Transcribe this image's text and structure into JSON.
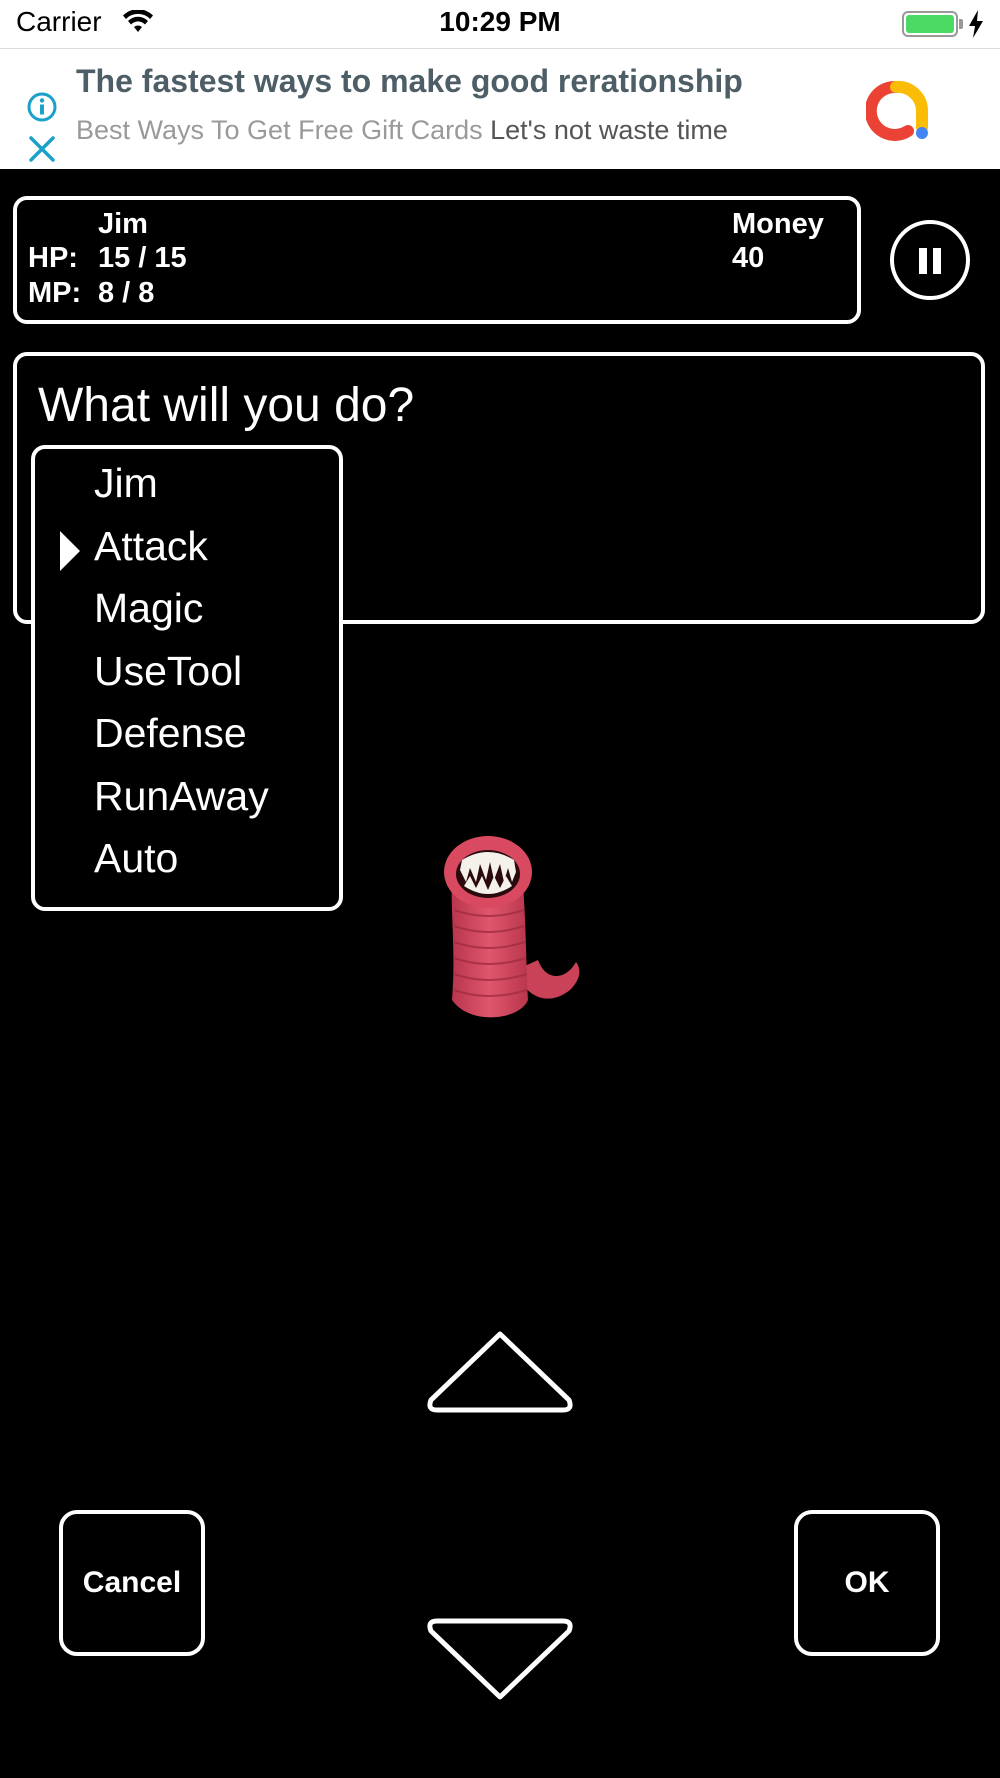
{
  "status_bar": {
    "carrier": "Carrier",
    "time": "10:29 PM",
    "wifi_icon": "wifi-icon",
    "battery_icon": "battery-icon",
    "charging_icon": "bolt-icon",
    "battery_color": "#4cd964"
  },
  "ad": {
    "title": "The fastest ways to make good rerationship",
    "subtitle_part1": "Best Ways To Get Free Gift Cards",
    "subtitle_part2": "Let's not waste time",
    "info_icon": "info-icon",
    "close_icon": "close-icon",
    "logo_icon": "advertiser-logo-icon",
    "accent_color": "#1ba1c9"
  },
  "party": {
    "name": "Jim",
    "hp_label": "HP:",
    "hp_value": "15 / 15",
    "mp_label": "MP:",
    "mp_value": "8 / 8",
    "money_label": "Money",
    "money_value": "40"
  },
  "pause_icon": "pause-icon",
  "message": "What will you do?",
  "command_menu": {
    "header": "Jim",
    "selected_index": 0,
    "items": [
      "Attack",
      "Magic",
      "UseTool",
      "Defense",
      "RunAway",
      "Auto"
    ]
  },
  "enemy": {
    "icon": "worm-monster-icon",
    "color": "#d9485f"
  },
  "controls": {
    "up_icon": "up-arrow-icon",
    "down_icon": "down-arrow-icon",
    "cancel_label": "Cancel",
    "ok_label": "OK"
  }
}
